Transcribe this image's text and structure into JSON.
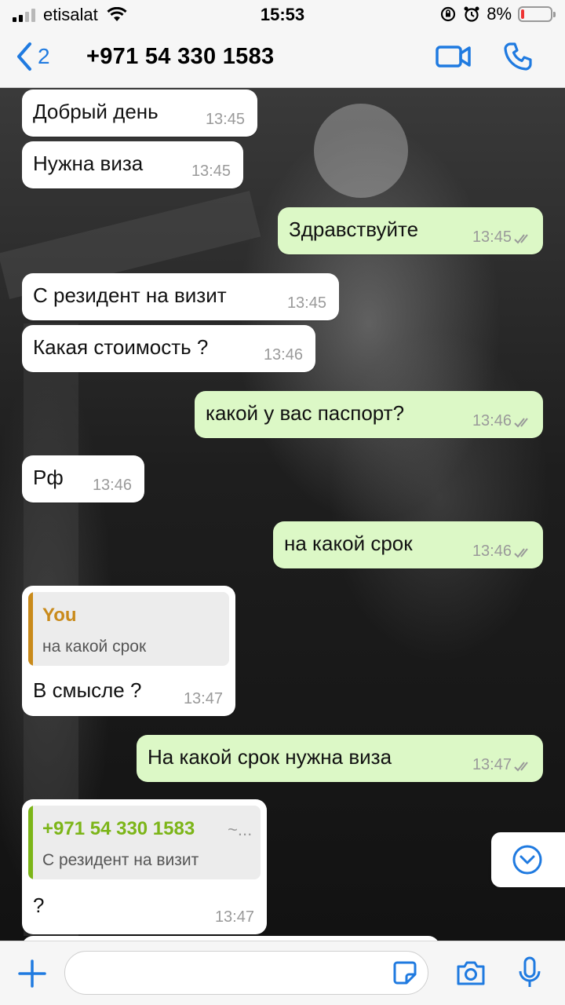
{
  "status_bar": {
    "carrier": "etisalat",
    "time": "15:53",
    "battery": "8%",
    "icons": [
      "signal-icon",
      "wifi-icon",
      "orientation-lock-icon",
      "alarm-icon",
      "battery-icon"
    ]
  },
  "header": {
    "back_count": "2",
    "contact": "+971 54 330 1583",
    "icons": [
      "back-chevron-icon",
      "video-call-icon",
      "phone-call-icon"
    ]
  },
  "messages": [
    {
      "dir": "in",
      "text": "Добрый день",
      "time": "13:45"
    },
    {
      "dir": "in",
      "text": "Нужна виза",
      "time": "13:45"
    },
    {
      "dir": "out",
      "text": "Здравствуйте",
      "time": "13:45"
    },
    {
      "dir": "in",
      "text": "С резидент на визит",
      "time": "13:45"
    },
    {
      "dir": "in",
      "text": "Какая стоимость ?",
      "time": "13:46"
    },
    {
      "dir": "out",
      "text": "какой у вас паспорт?",
      "time": "13:46"
    },
    {
      "dir": "in",
      "text": "Рф",
      "time": "13:46"
    },
    {
      "dir": "out",
      "text": "на какой срок",
      "time": "13:46"
    },
    {
      "dir": "in",
      "text": "В смысле ?",
      "time": "13:47",
      "quote": {
        "name": "You",
        "text": "на какой срок",
        "color": "#c98a1a"
      }
    },
    {
      "dir": "out",
      "text": "На какой срок нужна виза",
      "time": "13:47"
    },
    {
      "dir": "in",
      "text": "?",
      "time": "13:47",
      "quote": {
        "name": "+971 54 330 1583",
        "suffix": "~...",
        "text": "С резидент на визит",
        "color": "#7cb518"
      }
    }
  ],
  "input": {
    "placeholder": ""
  },
  "colors": {
    "accent": "#1f7ae0",
    "outgoing_bubble": "#dcf8c6",
    "incoming_bubble": "#ffffff"
  }
}
